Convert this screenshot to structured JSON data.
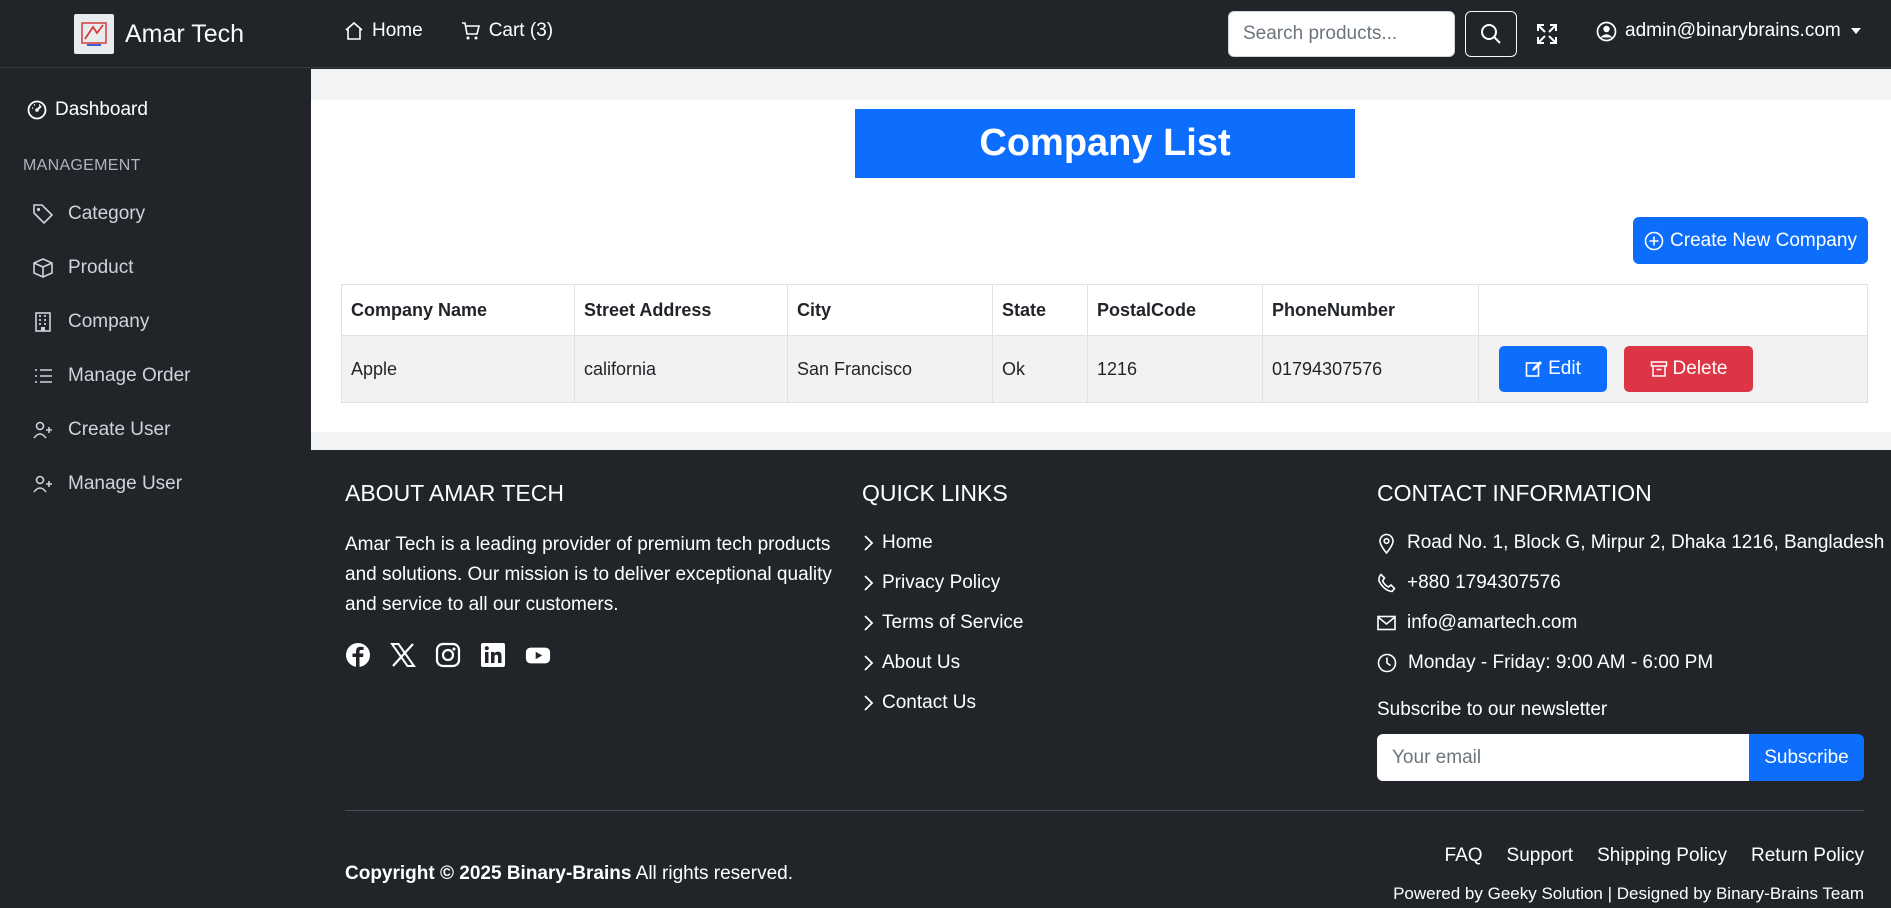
{
  "brand": {
    "name": "Amar Tech",
    "logo_icon": "store-logo-icon"
  },
  "nav": {
    "home": "Home",
    "cart": "Cart (3)",
    "search_placeholder": "Search products...",
    "user_email": "admin@binarybrains.com"
  },
  "sidebar": {
    "dashboard": "Dashboard",
    "heading": "MANAGEMENT",
    "items": [
      {
        "label": "Category",
        "icon": "tag-icon"
      },
      {
        "label": "Product",
        "icon": "box-icon"
      },
      {
        "label": "Company",
        "icon": "building-icon"
      },
      {
        "label": "Manage Order",
        "icon": "list-icon"
      },
      {
        "label": "Create User",
        "icon": "user-plus-icon"
      },
      {
        "label": "Manage User",
        "icon": "user-plus-icon"
      }
    ]
  },
  "main": {
    "title": "Company List",
    "create_button": "Create New Company",
    "table": {
      "headers": [
        "Company Name",
        "Street Address",
        "City",
        "State",
        "PostalCode",
        "PhoneNumber",
        ""
      ],
      "rows": [
        {
          "name": "Apple",
          "street": "california",
          "city": "San Francisco",
          "state": "Ok",
          "postal": "1216",
          "phone": "01794307576"
        }
      ],
      "edit_label": "Edit",
      "delete_label": "Delete"
    }
  },
  "footer": {
    "about_heading": "ABOUT AMAR TECH",
    "about_text": "Amar Tech is a leading provider of premium tech products and solutions. Our mission is to deliver exceptional quality and service to all our customers.",
    "social_icons": [
      "facebook-icon",
      "x-twitter-icon",
      "instagram-icon",
      "linkedin-icon",
      "youtube-icon"
    ],
    "quick_heading": "QUICK LINKS",
    "quick_links": [
      "Home",
      "Privacy Policy",
      "Terms of Service",
      "About Us",
      "Contact Us"
    ],
    "contact_heading": "CONTACT INFORMATION",
    "contact": {
      "address": "Road No. 1, Block G, Mirpur 2, Dhaka 1216, Bangladesh",
      "phone": "+880 1794307576",
      "email": "info@amartech.com",
      "hours": "Monday - Friday: 9:00 AM - 6:00 PM"
    },
    "newsletter_label": "Subscribe to our newsletter",
    "email_placeholder": "Your email",
    "subscribe": "Subscribe",
    "copyright_bold": "Copyright © 2025 Binary-Brains",
    "copyright_rest": " All rights reserved.",
    "policy_links": [
      "FAQ",
      "Support",
      "Shipping Policy",
      "Return Policy"
    ],
    "powered": "Powered by Geeky Solution | Designed by Binary-Brains Team"
  },
  "colors": {
    "primary": "#0d6efd",
    "danger": "#dc3545",
    "dark": "#212529"
  }
}
